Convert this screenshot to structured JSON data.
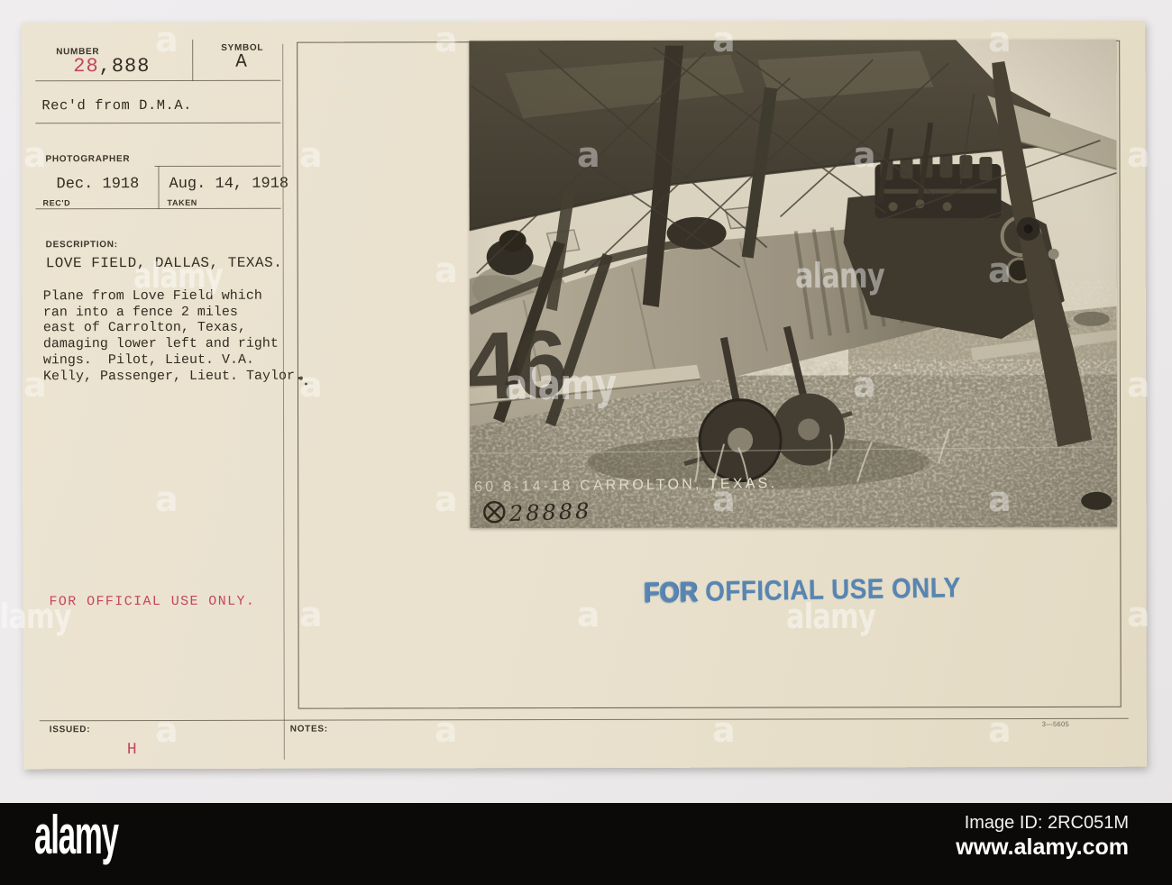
{
  "colors": {
    "page_background": "#eceaeb",
    "card_background": "#e9e1cd",
    "typed_ink": "#332c21",
    "red_ink": "#c6455a",
    "stamp_blue": "#4076ad",
    "photo_border": "#655c4a",
    "footer_bar": "#0b0a08"
  },
  "card": {
    "number_label": "NUMBER",
    "number_red": "28",
    "number_rest": ",888",
    "symbol_label": "SYMBOL",
    "symbol_value": "A",
    "received_from": "Rec'd from D.M.A.",
    "photographer_label": "PHOTOGRAPHER",
    "recd_date": "Dec. 1918",
    "recd_label": "REC'D",
    "taken_date": "Aug. 14, 1918",
    "taken_label": "TAKEN",
    "description_label": "DESCRIPTION:",
    "description_title": "LOVE FIELD, DALLAS, TEXAS.",
    "description_lines": [
      "Plane from Love Field which",
      "ran into a fence 2 miles",
      "east of Carrolton, Texas,",
      "damaging lower left and right",
      "wings.  Pilot, Lieut. V.A.",
      "Kelly, Passenger, Lieut. Taylor."
    ],
    "official_use_typed": "FOR OFFICIAL USE ONLY.",
    "issued_label": "ISSUED:",
    "issued_value": "H",
    "notes_label": "NOTES:",
    "form_number": "3—5605",
    "stamp_word1": "FOR",
    "stamp_rest": "OFFICIAL USE ONLY"
  },
  "photo": {
    "marking": "46",
    "caption_white": "60 8-14-18 CARROLTON, TEXAS.",
    "caption_black": "28888"
  },
  "watermark": {
    "letter": "a",
    "word": "alamy"
  },
  "footer": {
    "logo": "alamy",
    "image_id": "Image ID: 2RC051M",
    "url": "www.alamy.com"
  }
}
